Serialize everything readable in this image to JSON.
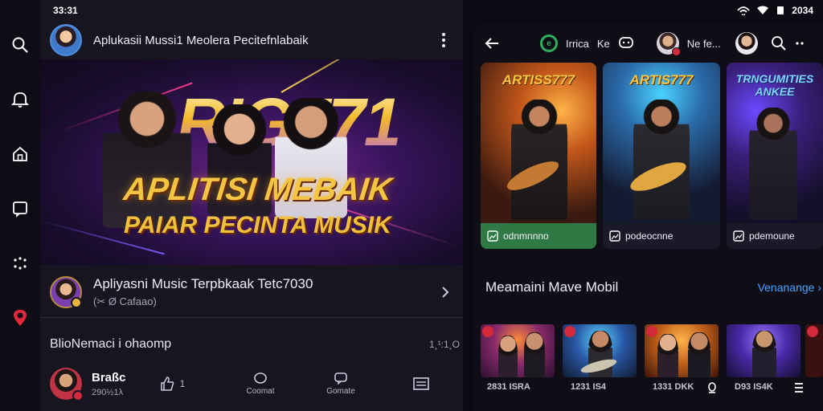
{
  "status": {
    "time": "33:31",
    "battery_text": "2034"
  },
  "nav_rail": {
    "items": [
      {
        "name": "search",
        "icon": "search-icon"
      },
      {
        "name": "notifications",
        "icon": "bell-icon"
      },
      {
        "name": "home",
        "icon": "home-icon"
      },
      {
        "name": "library",
        "icon": "library-icon"
      },
      {
        "name": "explore",
        "icon": "dots-icon"
      },
      {
        "name": "location",
        "icon": "location-pin-icon",
        "color": "#e0283a"
      }
    ]
  },
  "header": {
    "title": "Aplukasii Mussi1 Meolera Pecitefnlabaik"
  },
  "hero": {
    "big_text": "RIG771",
    "headline": "APLITISI MEBAIK",
    "subline": "PAIAR PECINTA MUSIK"
  },
  "featured": {
    "title": "Apliyasni Music Terpbkaak Tetc7030",
    "subtitle": "(✂ Ø Cafaao)"
  },
  "comments": {
    "heading": "BlioNemaci i ohaomp",
    "time": "1¸¹:1¸O"
  },
  "user": {
    "name": "Braßc",
    "count": "290½1λ"
  },
  "actions": {
    "like_count": "1",
    "comment_label": "Coomat",
    "share_label": "Gomate"
  },
  "right_header": {
    "back": "back",
    "label1": "Irrica",
    "label2": "Ke",
    "label3": "Ne fe..."
  },
  "artist_cards": [
    {
      "title": "ARTISS777",
      "footer": "odnmnnno",
      "accent": "#2f7a44"
    },
    {
      "title": "ARTIS777",
      "footer": "podeocnne",
      "accent": "#1a1928"
    },
    {
      "title": "TRNGUMITIES ANKEE",
      "footer": "pdemoune",
      "accent": "#1a1928"
    }
  ],
  "section": {
    "title": "Meamaini Mave Mobil",
    "link": "Venanange"
  },
  "thumbs": [
    {
      "label": "2831 ISRA"
    },
    {
      "label": "1231 IS4"
    },
    {
      "label": "1331 DKK"
    },
    {
      "label": "D93 IS4K"
    }
  ],
  "colors": {
    "accent_gold": "#f5c542",
    "link_blue": "#4aa3ff",
    "brand_green": "#2fae5e",
    "alert_red": "#e0283a"
  }
}
